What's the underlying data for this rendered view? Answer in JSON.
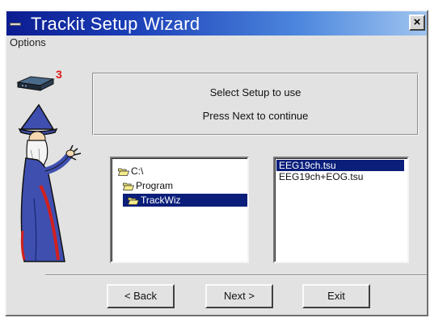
{
  "window": {
    "title": "Trackit Setup Wizard",
    "close_glyph": "×",
    "title_gradient": [
      "#0c1c90",
      "#9fc4ef"
    ]
  },
  "menu": {
    "items": [
      "Options"
    ]
  },
  "badge": {
    "count": "3",
    "color": "#e01818"
  },
  "message": {
    "line1": "Select Setup to use",
    "line2": "Press Next to continue"
  },
  "tree": {
    "items": [
      {
        "label": "C:\\",
        "icon": "open-folder-icon",
        "selected": false
      },
      {
        "label": "Program",
        "icon": "open-folder-icon",
        "selected": false
      },
      {
        "label": "TrackWiz",
        "icon": "open-folder-icon",
        "selected": true
      }
    ]
  },
  "files": {
    "items": [
      {
        "label": "EEG19ch.tsu",
        "selected": true
      },
      {
        "label": "EEG19ch+EOG.tsu",
        "selected": false
      }
    ]
  },
  "buttons": {
    "back": "< Back",
    "next": "Next >",
    "exit": "Exit"
  },
  "colors": {
    "selection": "#0a1e7a",
    "dialog_bg": "#e2e2e2"
  }
}
